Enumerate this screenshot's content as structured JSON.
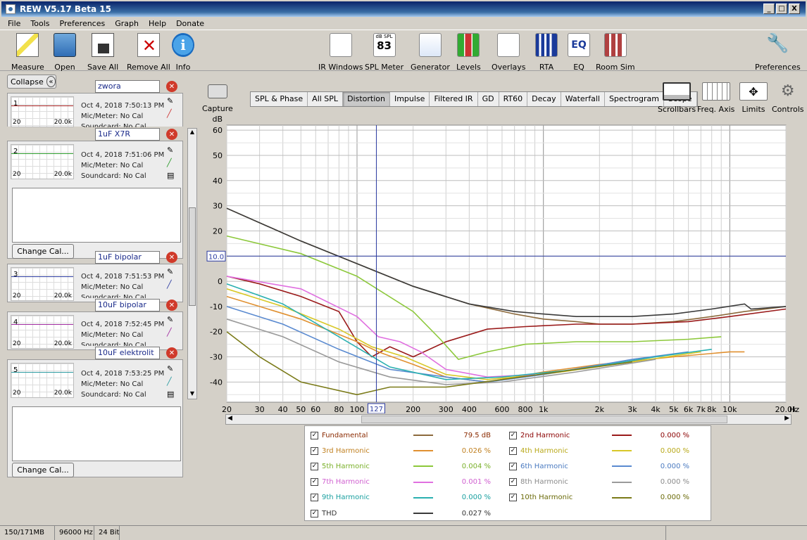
{
  "window": {
    "title": "REW V5.17 Beta 15",
    "min": "_",
    "max": "□",
    "close": "X"
  },
  "menu": [
    "File",
    "Tools",
    "Preferences",
    "Graph",
    "Help",
    "Donate"
  ],
  "toolbar": {
    "left": [
      {
        "label": "Measure",
        "icon": "measure-icon"
      },
      {
        "label": "Open",
        "icon": "folder-icon"
      },
      {
        "label": "Save All",
        "icon": "save-icon"
      },
      {
        "label": "Remove All",
        "icon": "remove-icon"
      },
      {
        "label": "Info",
        "icon": "info-icon"
      }
    ],
    "center": [
      {
        "label": "IR Windows",
        "icon": "ir-windows-icon"
      },
      {
        "label": "SPL Meter",
        "icon": "spl-meter-icon",
        "readout_top": "dB SPL",
        "readout_value": "83"
      },
      {
        "label": "Generator",
        "icon": "generator-icon"
      },
      {
        "label": "Levels",
        "icon": "levels-icon"
      },
      {
        "label": "Overlays",
        "icon": "overlays-icon"
      },
      {
        "label": "RTA",
        "icon": "rta-icon"
      },
      {
        "label": "EQ",
        "icon": "eq-icon"
      },
      {
        "label": "Room Sim",
        "icon": "room-sim-icon"
      }
    ],
    "right": {
      "label": "Preferences",
      "icon": "wrench-icon"
    }
  },
  "sidebar": {
    "collapse": "Collapse",
    "collapse_glyph": "«",
    "change_cal": "Change Cal...",
    "measurements": [
      {
        "num": "1",
        "name": "zwora",
        "date": "Oct 4, 2018 7:50:13 PM",
        "mic": "Mic/Meter: No Cal",
        "card": "Soundcard: No Cal",
        "color": "#a01818",
        "lo": "20",
        "hi": "20.0k"
      },
      {
        "num": "2",
        "name": "1uF X7R",
        "date": "Oct 4, 2018 7:51:06 PM",
        "mic": "Mic/Meter: No Cal",
        "card": "Soundcard: No Cal",
        "color": "#2a9a2a",
        "lo": "20",
        "hi": "20.0k"
      },
      {
        "num": "3",
        "name": "1uF bipolar",
        "date": "Oct 4, 2018 7:51:53 PM",
        "mic": "Mic/Meter: No Cal",
        "card": "Soundcard: No Cal",
        "color": "#2a3aa0",
        "lo": "20",
        "hi": "20.0k"
      },
      {
        "num": "4",
        "name": "10uF bipolar",
        "date": "Oct 4, 2018 7:52:45 PM",
        "mic": "Mic/Meter: No Cal",
        "card": "Soundcard: No Cal",
        "color": "#a02aa0",
        "lo": "20",
        "hi": "20.0k"
      },
      {
        "num": "5",
        "name": "10uF elektrolit",
        "date": "Oct 4, 2018 7:53:25 PM",
        "mic": "Mic/Meter: No Cal",
        "card": "Soundcard: No Cal",
        "color": "#2a9aa0",
        "lo": "20",
        "hi": "20.0k"
      }
    ]
  },
  "capture": "Capture",
  "tabs": [
    "SPL & Phase",
    "All SPL",
    "Distortion",
    "Impulse",
    "Filtered IR",
    "GD",
    "RT60",
    "Decay",
    "Waterfall",
    "Spectrogram",
    "Scope"
  ],
  "selected_tab": "Distortion",
  "right_tools": [
    {
      "label": "Scrollbars",
      "icon": "scrollbars-icon"
    },
    {
      "label": "Freq. Axis",
      "icon": "freq-axis-icon"
    },
    {
      "label": "Limits",
      "icon": "limits-icon"
    },
    {
      "label": "Controls",
      "icon": "controls-gear-icon"
    }
  ],
  "chart_data": {
    "type": "line",
    "ylabel": "dB",
    "xunit": "Hz",
    "ylim": [
      -48,
      62
    ],
    "xlim": [
      20,
      20000
    ],
    "x_scale": "log",
    "grid": true,
    "yticks": [
      60,
      50,
      40,
      30,
      20,
      10,
      0,
      -10,
      -20,
      -30,
      -40
    ],
    "xticks": [
      {
        "v": 20,
        "l": "20"
      },
      {
        "v": 30,
        "l": "30"
      },
      {
        "v": 40,
        "l": "40"
      },
      {
        "v": 50,
        "l": "50"
      },
      {
        "v": 60,
        "l": "60"
      },
      {
        "v": 80,
        "l": "80"
      },
      {
        "v": 100,
        "l": "100"
      },
      {
        "v": 200,
        "l": "200"
      },
      {
        "v": 300,
        "l": "300"
      },
      {
        "v": 400,
        "l": "400"
      },
      {
        "v": 600,
        "l": "600"
      },
      {
        "v": 800,
        "l": "800"
      },
      {
        "v": 1000,
        "l": "1k"
      },
      {
        "v": 2000,
        "l": "2k"
      },
      {
        "v": 3000,
        "l": "3k"
      },
      {
        "v": 4000,
        "l": "4k"
      },
      {
        "v": 5000,
        "l": "5k"
      },
      {
        "v": 6000,
        "l": "6k"
      },
      {
        "v": 7000,
        "l": "7k"
      },
      {
        "v": 8000,
        "l": "8k"
      },
      {
        "v": 10000,
        "l": "10k"
      },
      {
        "v": 20000,
        "l": "20.0k"
      }
    ],
    "cursor": {
      "x": 127,
      "y": 10.0,
      "x_label": "127",
      "y_label": "10.0"
    },
    "series": [
      {
        "name": "Fundamental",
        "color": "#8c6a3c",
        "x": [
          20,
          50,
          100,
          200,
          400,
          700,
          1000,
          1500,
          2000,
          3000,
          5000,
          8000,
          12000,
          20000
        ],
        "y": [
          29,
          16,
          7,
          -2,
          -9,
          -13,
          -15,
          -16,
          -17,
          -17,
          -16,
          -14,
          -12,
          -10
        ]
      },
      {
        "name": "2nd Harmonic",
        "color": "#9a1a1a",
        "x": [
          20,
          30,
          50,
          80,
          100,
          120,
          150,
          200,
          300,
          500,
          800,
          1500,
          3000,
          6000,
          10000,
          20000
        ],
        "y": [
          2,
          -1,
          -6,
          -12,
          -24,
          -30,
          -26,
          -30,
          -24,
          -19,
          -18,
          -17,
          -17,
          -16,
          -14,
          -11
        ]
      },
      {
        "name": "3rd Harmonic",
        "color": "#e09030",
        "x": [
          20,
          50,
          100,
          130,
          200,
          300,
          500,
          1000,
          2000,
          5000,
          10000,
          12000
        ],
        "y": [
          -6,
          -15,
          -24,
          -28,
          -33,
          -38,
          -40,
          -36,
          -33,
          -30,
          -28,
          -28
        ]
      },
      {
        "name": "4th Harmonic",
        "color": "#d8c828",
        "x": [
          20,
          40,
          80,
          120,
          180,
          300,
          500,
          1000,
          3000,
          7000
        ],
        "y": [
          -3,
          -10,
          -19,
          -26,
          -30,
          -37,
          -39,
          -37,
          -32,
          -28
        ]
      },
      {
        "name": "5th Harmonic",
        "color": "#8cc83a",
        "x": [
          20,
          50,
          100,
          200,
          280,
          350,
          500,
          800,
          1500,
          3000,
          6000,
          9000
        ],
        "y": [
          18,
          11,
          2,
          -12,
          -23,
          -31,
          -28,
          -25,
          -24,
          -24,
          -23,
          -22
        ]
      },
      {
        "name": "6th Harmonic",
        "color": "#5a8ad0",
        "x": [
          20,
          40,
          80,
          150,
          300,
          500,
          1000,
          3000,
          6000
        ],
        "y": [
          -10,
          -17,
          -27,
          -35,
          -38,
          -40,
          -37,
          -31,
          -28
        ]
      },
      {
        "name": "7th Harmonic",
        "color": "#e070e0",
        "x": [
          20,
          50,
          100,
          130,
          170,
          220,
          300,
          500,
          900
        ],
        "y": [
          2,
          -3,
          -14,
          -22,
          -24,
          -28,
          -35,
          -38,
          -37
        ]
      },
      {
        "name": "8th Harmonic",
        "color": "#9a9a9a",
        "x": [
          20,
          40,
          80,
          150,
          300,
          600,
          1500,
          4000
        ],
        "y": [
          -15,
          -22,
          -32,
          -38,
          -41,
          -40,
          -36,
          -31
        ]
      },
      {
        "name": "9th Harmonic",
        "color": "#2ab0b0",
        "x": [
          20,
          40,
          80,
          150,
          300,
          600,
          1500,
          4000,
          8000
        ],
        "y": [
          -1,
          -9,
          -22,
          -34,
          -39,
          -38,
          -35,
          -30,
          -27
        ]
      },
      {
        "name": "10th Harmonic",
        "color": "#7a7a18",
        "x": [
          20,
          30,
          50,
          100,
          150,
          300,
          600,
          1500,
          3000
        ],
        "y": [
          -20,
          -30,
          -40,
          -45,
          -42,
          -42,
          -39,
          -35,
          -32
        ]
      },
      {
        "name": "THD",
        "color": "#3a3a3a",
        "x": [
          20,
          50,
          100,
          200,
          400,
          700,
          1000,
          1500,
          2000,
          3000,
          5000,
          8000,
          12000,
          13000,
          20000
        ],
        "y": [
          29,
          16,
          7,
          -2,
          -9,
          -12,
          -13,
          -14,
          -14,
          -14,
          -13,
          -11,
          -9,
          -11,
          -10
        ]
      }
    ]
  },
  "legend": [
    {
      "name": "Fundamental",
      "value": "79.5 dB",
      "color": "#8c6a3c",
      "text": "#8a2a00"
    },
    {
      "name": "2nd Harmonic",
      "value": "0.000 %",
      "color": "#9a1a1a",
      "text": "#8a0000"
    },
    {
      "name": "3rd Harmonic",
      "value": "0.026 %",
      "color": "#e09030",
      "text": "#c08020"
    },
    {
      "name": "4th Harmonic",
      "value": "0.000 %",
      "color": "#d8c828",
      "text": "#b8a818"
    },
    {
      "name": "5th Harmonic",
      "value": "0.004 %",
      "color": "#8cc83a",
      "text": "#7ab02a"
    },
    {
      "name": "6th Harmonic",
      "value": "0.000 %",
      "color": "#5a8ad0",
      "text": "#4a7ac0"
    },
    {
      "name": "7th Harmonic",
      "value": "0.001 %",
      "color": "#e070e0",
      "text": "#d060d0"
    },
    {
      "name": "8th Harmonic",
      "value": "0.000 %",
      "color": "#9a9a9a",
      "text": "#8a8a8a"
    },
    {
      "name": "9th Harmonic",
      "value": "0.000 %",
      "color": "#2ab0b0",
      "text": "#1aa0a0"
    },
    {
      "name": "10th Harmonic",
      "value": "0.000 %",
      "color": "#7a7a18",
      "text": "#6a6a08"
    },
    {
      "name": "THD",
      "value": "0.027 %",
      "color": "#3a3a3a",
      "text": "#333333"
    }
  ],
  "legend_check": "✓",
  "status": [
    "150/171MB",
    "96000 Hz",
    "24 Bit"
  ]
}
